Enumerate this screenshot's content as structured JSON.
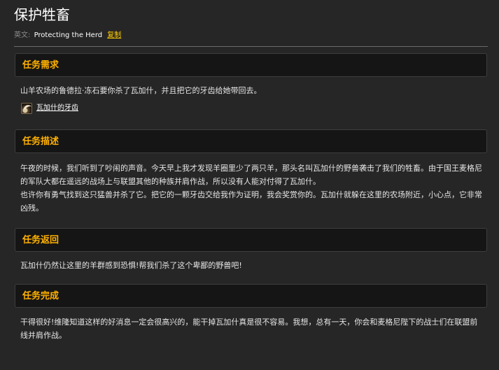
{
  "quest": {
    "title": "保护牲畜",
    "english_label": "英文:",
    "english_name": "Protecting the Herd",
    "copy_label": "复制"
  },
  "sections": {
    "requirements": {
      "header": "任务需求",
      "text": "山羊农场的鲁德拉·冻石要你杀了瓦加什，并且把它的牙齿给她带回去。",
      "item": {
        "name": "瓦加什的牙齿",
        "icon": "fang-icon"
      }
    },
    "description": {
      "header": "任务描述",
      "paragraph1": "午夜的时候，我们听到了吵闹的声音。今天早上我才发现羊圈里少了两只羊，那头名叫瓦加什的野兽袭击了我们的牲畜。由于国王麦格尼的军队大都在遥远的战场上与联盟其他的种族并肩作战，所以没有人能对付得了瓦加什。",
      "paragraph2": "也许你有勇气找到这只猛兽并杀了它。把它的一颗牙齿交给我作为证明，我会奖赏你的。瓦加什就躲在这里的农场附近，小心点，它非常凶残。"
    },
    "progress": {
      "header": "任务返回",
      "text": "瓦加什仍然让这里的羊群感到恐惧!帮我们杀了这个卑鄙的野兽吧!"
    },
    "completion": {
      "header": "任务完成",
      "text": "干得很好!维隆知道这样的好消息一定会很高兴的，能干掉瓦加什真是很不容易。我想，总有一天，你会和麦格尼陛下的战士们在联盟前线并肩作战。"
    }
  },
  "colors": {
    "background": "#262626",
    "header_background": "#151515",
    "header_text": "#ffb100",
    "link_yellow": "#ffcc00"
  }
}
